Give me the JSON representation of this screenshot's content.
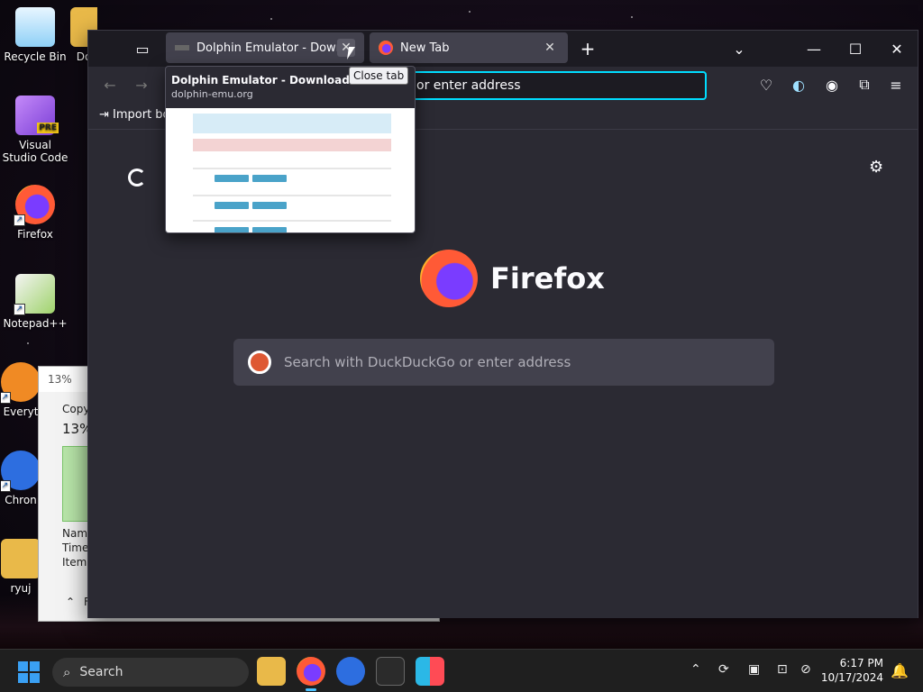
{
  "desktop": {
    "icons": [
      {
        "label": "Recycle Bin"
      },
      {
        "label": "Do"
      },
      {
        "label": "Visual Studio Code",
        "badge": "PRE"
      },
      {
        "label": "Firefox"
      },
      {
        "label": "Notepad++"
      },
      {
        "label": "Everyt"
      },
      {
        "label": "Chron"
      },
      {
        "label": "ryuj"
      }
    ]
  },
  "copy_dialog": {
    "title": "13%",
    "status": "Copy",
    "percent": "13%",
    "progress_fraction": 0.13,
    "details": [
      "Name",
      "Time",
      "Items"
    ],
    "more_details": "F"
  },
  "browser": {
    "tabs": [
      {
        "label": "Dolphin Emulator - Download",
        "close": "✕"
      },
      {
        "label": "New Tab",
        "close": "✕"
      }
    ],
    "new_tab": "+",
    "urlbar_text": "or enter address",
    "bookmark": "Import bo",
    "brand": "Firefox",
    "search_placeholder": "Search with DuckDuckGo or enter address",
    "tab_preview": {
      "title": "Dolphin Emulator - Download",
      "url": "dolphin-emu.org"
    },
    "tooltip": "Close tab"
  },
  "taskbar": {
    "search_label": "Search",
    "time": "6:17 PM",
    "date": "10/17/2024"
  },
  "colors": {
    "accent_focus": "#00ddff",
    "tab_bg": "#42414d",
    "taskbar_accent": "#4cc2ff"
  }
}
